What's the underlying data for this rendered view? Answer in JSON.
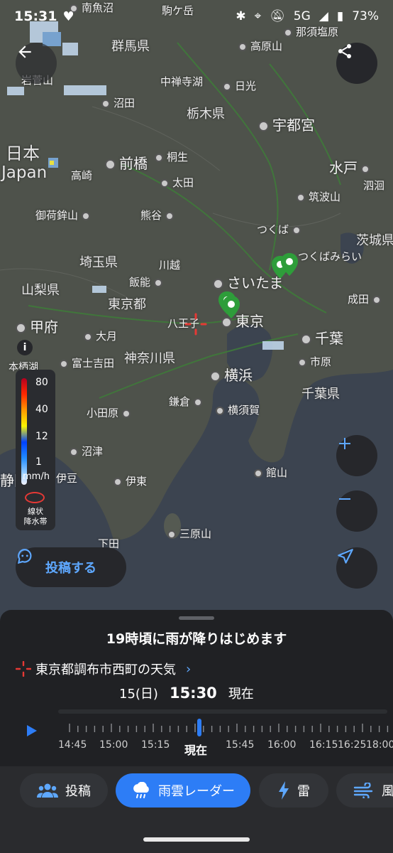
{
  "status": {
    "time": "15:31",
    "network": "5G",
    "battery": "73%"
  },
  "map": {
    "regions": [
      {
        "id": "gunma",
        "label": "群馬県"
      },
      {
        "id": "tochigi",
        "label": "栃木県"
      },
      {
        "id": "saitama",
        "label": "埼玉県"
      },
      {
        "id": "yamanashi",
        "label": "山梨県"
      },
      {
        "id": "tokyo_to",
        "label": "東京都"
      },
      {
        "id": "kanagawa",
        "label": "神奈川県"
      },
      {
        "id": "ibaraki",
        "label": "茨城県"
      },
      {
        "id": "chiba_ken",
        "label": "千葉県"
      },
      {
        "id": "japan_ja",
        "label": "日本"
      },
      {
        "id": "japan_en",
        "label": "Japan"
      }
    ],
    "places": [
      {
        "id": "minamiuonuma",
        "label": "南魚沼"
      },
      {
        "id": "komagatake",
        "label": "駒ケ岳"
      },
      {
        "id": "nasushiobara",
        "label": "那須塩原"
      },
      {
        "id": "takaharayama",
        "label": "高原山"
      },
      {
        "id": "chuzenjiko",
        "label": "中禅寺湖"
      },
      {
        "id": "nikko",
        "label": "日光"
      },
      {
        "id": "numata",
        "label": "沼田"
      },
      {
        "id": "utsunomiya",
        "label": "宇都宮"
      },
      {
        "id": "maebashi",
        "label": "前橋"
      },
      {
        "id": "kiryu",
        "label": "桐生"
      },
      {
        "id": "takasaki",
        "label": "高崎"
      },
      {
        "id": "ota",
        "label": "太田"
      },
      {
        "id": "mito",
        "label": "水戸"
      },
      {
        "id": "hokota",
        "label": "泗洄"
      },
      {
        "id": "tsukubasan",
        "label": "筑波山"
      },
      {
        "id": "mikabuyama",
        "label": "御荷鉾山"
      },
      {
        "id": "kumagaya",
        "label": "熊谷"
      },
      {
        "id": "tsukuba",
        "label": "つくば"
      },
      {
        "id": "tsukubamirai",
        "label": "つくばみらい"
      },
      {
        "id": "kawagoe",
        "label": "川越"
      },
      {
        "id": "saitama",
        "label": "さいたま"
      },
      {
        "id": "hanno",
        "label": "飯能"
      },
      {
        "id": "narita",
        "label": "成田"
      },
      {
        "id": "tokyo",
        "label": "東京"
      },
      {
        "id": "kofu",
        "label": "甲府"
      },
      {
        "id": "hachioji",
        "label": "八王子"
      },
      {
        "id": "otsuki",
        "label": "大月"
      },
      {
        "id": "chiba",
        "label": "千葉"
      },
      {
        "id": "fujiyoshida",
        "label": "富士吉田"
      },
      {
        "id": "ichihara",
        "label": "市原"
      },
      {
        "id": "yokohama",
        "label": "横浜"
      },
      {
        "id": "kamakura",
        "label": "鎌倉"
      },
      {
        "id": "yokosuka",
        "label": "横須賀"
      },
      {
        "id": "odawara",
        "label": "小田原"
      },
      {
        "id": "numazu",
        "label": "沼津"
      },
      {
        "id": "tateyama",
        "label": "館山"
      },
      {
        "id": "izu",
        "label": "伊豆"
      },
      {
        "id": "ito",
        "label": "伊東"
      },
      {
        "id": "miharayama",
        "label": "三原山"
      },
      {
        "id": "shimoda",
        "label": "下田"
      },
      {
        "id": "shizuoka",
        "label": "静岡"
      },
      {
        "id": "iwazoyama",
        "label": "岩菅山"
      },
      {
        "id": "motosuko",
        "label": "本栖湖"
      }
    ]
  },
  "legend": {
    "values": [
      "80",
      "40",
      "12",
      "1"
    ],
    "unit": "mm/h",
    "band_label": "線状\n降水帯",
    "colors": [
      "#b40020",
      "#ff2800",
      "#ff9900",
      "#faf500",
      "#0041ff",
      "#218cff",
      "#a0d2ff",
      "#f2f2ff"
    ]
  },
  "post_button": {
    "label": "投稿する"
  },
  "sheet": {
    "forecast": "19時頃に雨が降りはじめます",
    "location": "東京都調布市西町の天気",
    "date": "15(日)",
    "time": "15:30",
    "now_suffix": "現在",
    "timeline_labels": [
      "14:45",
      "15:00",
      "15:15",
      "現在",
      "15:45",
      "16:00",
      "16:15",
      "16:25",
      "18:00"
    ],
    "progress": 0.42
  },
  "tabs": [
    {
      "id": "post",
      "label": "投稿",
      "icon": "people-icon",
      "active": false
    },
    {
      "id": "radar",
      "label": "雨雲レーダー",
      "icon": "rain-cloud-icon",
      "active": true
    },
    {
      "id": "thunder",
      "label": "雷",
      "icon": "lightning-icon",
      "active": false
    },
    {
      "id": "wind",
      "label": "風",
      "icon": "wind-icon",
      "active": false
    }
  ],
  "colors": {
    "accent": "#2d7df6",
    "link": "#5ea8ff",
    "target": "#e53935"
  }
}
